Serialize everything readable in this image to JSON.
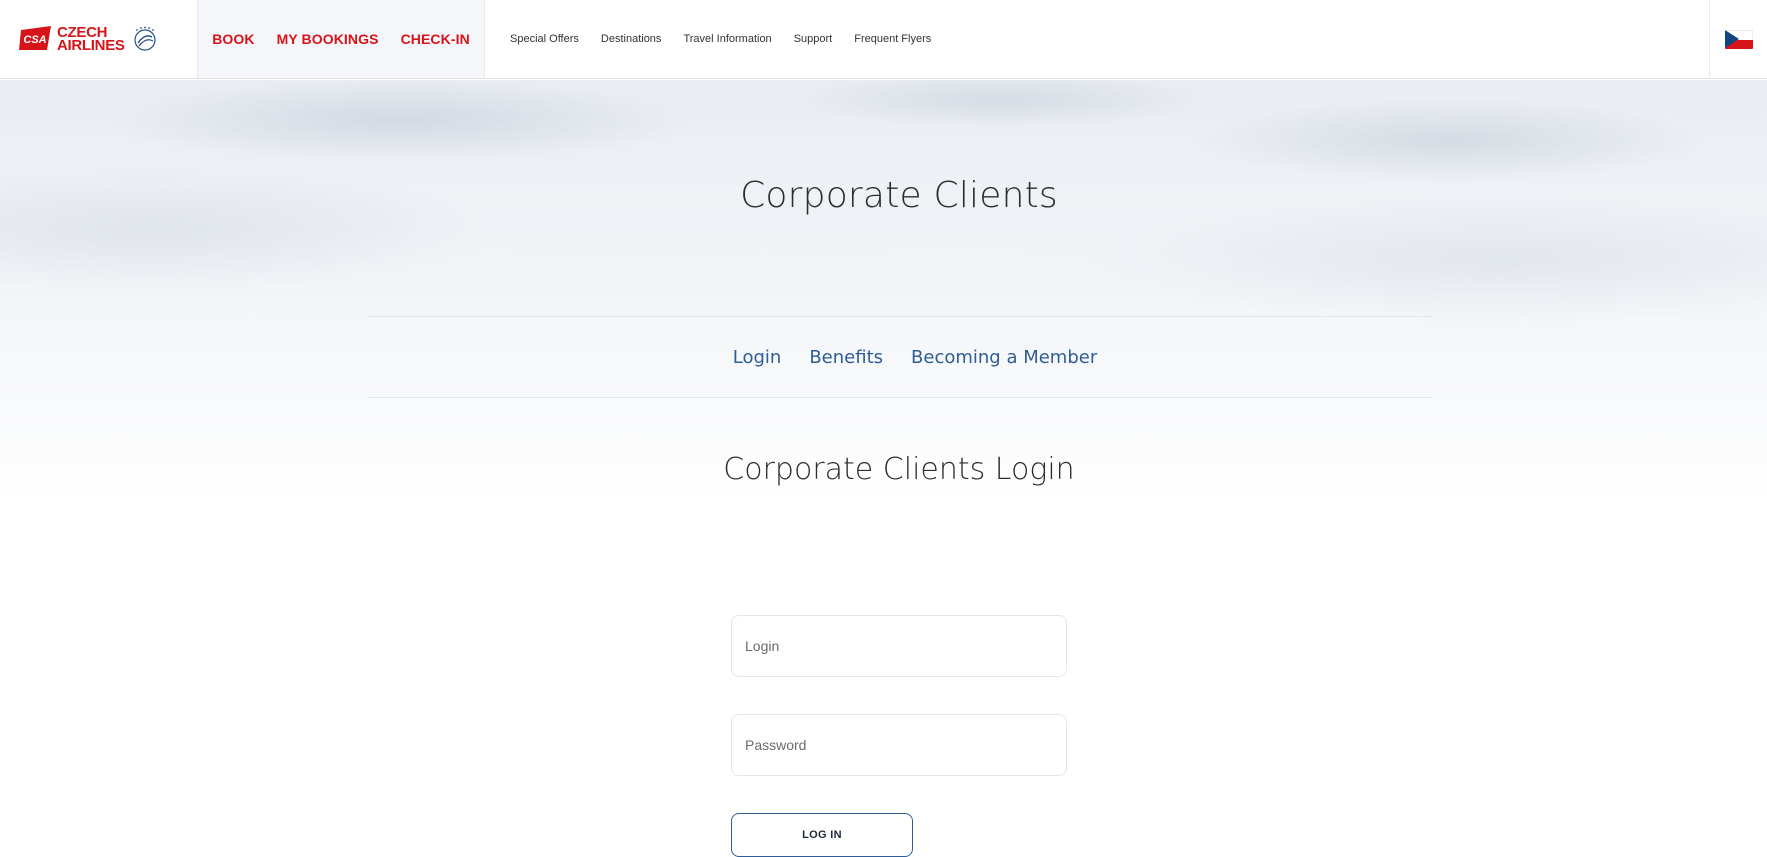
{
  "header": {
    "logo": {
      "badge_text": "CSA",
      "line1": "CZECH",
      "line2": "AIRLINES",
      "alliance_icon": "skyteam-icon"
    },
    "primary_nav": [
      {
        "label": "BOOK"
      },
      {
        "label": "MY BOOKINGS"
      },
      {
        "label": "CHECK-IN"
      }
    ],
    "secondary_nav": [
      {
        "label": "Special Offers"
      },
      {
        "label": "Destinations"
      },
      {
        "label": "Travel Information"
      },
      {
        "label": "Support"
      },
      {
        "label": "Frequent Flyers"
      }
    ],
    "language_icon": "czech-flag-icon"
  },
  "main": {
    "title": "Corporate Clients",
    "tabs": [
      {
        "label": "Login"
      },
      {
        "label": "Benefits"
      },
      {
        "label": "Becoming a Member"
      }
    ],
    "login_section": {
      "title": "Corporate Clients Login",
      "login_placeholder": "Login",
      "password_placeholder": "Password",
      "button_label": "LOG IN"
    }
  },
  "colors": {
    "brand_red": "#d7141a",
    "link_blue": "#2f5d94",
    "flag_blue": "#11457e"
  }
}
